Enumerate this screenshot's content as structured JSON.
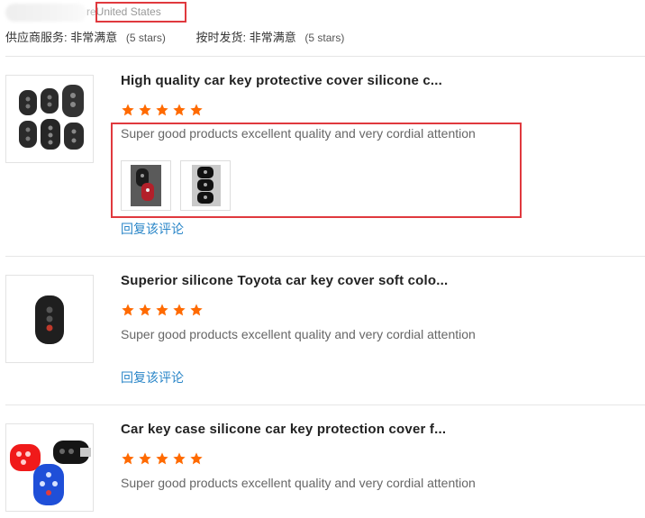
{
  "reviewer": {
    "country_prefix": "re",
    "country": "United States"
  },
  "ratings": [
    {
      "label": "供应商服务:",
      "value": "非常满意",
      "stars": "(5 stars)"
    },
    {
      "label": "按时发货:",
      "value": "非常满意",
      "stars": "(5 stars)"
    }
  ],
  "reviews": [
    {
      "title": "High quality car key protective cover silicone c...",
      "rating": 5,
      "comment": "Super good products excellent quality and very cordial attention",
      "reply": "回复该评论"
    },
    {
      "title": "Superior silicone Toyota car key cover soft colo...",
      "rating": 5,
      "comment": "Super good products excellent quality and very cordial attention",
      "reply": "回复该评论"
    },
    {
      "title": "Car key case silicone car key protection cover f...",
      "rating": 5,
      "comment": "Super good products excellent quality and very cordial attention"
    }
  ],
  "colors": {
    "star": "#ff6a00",
    "link": "#2a86c8",
    "highlight": "#e0393e"
  }
}
